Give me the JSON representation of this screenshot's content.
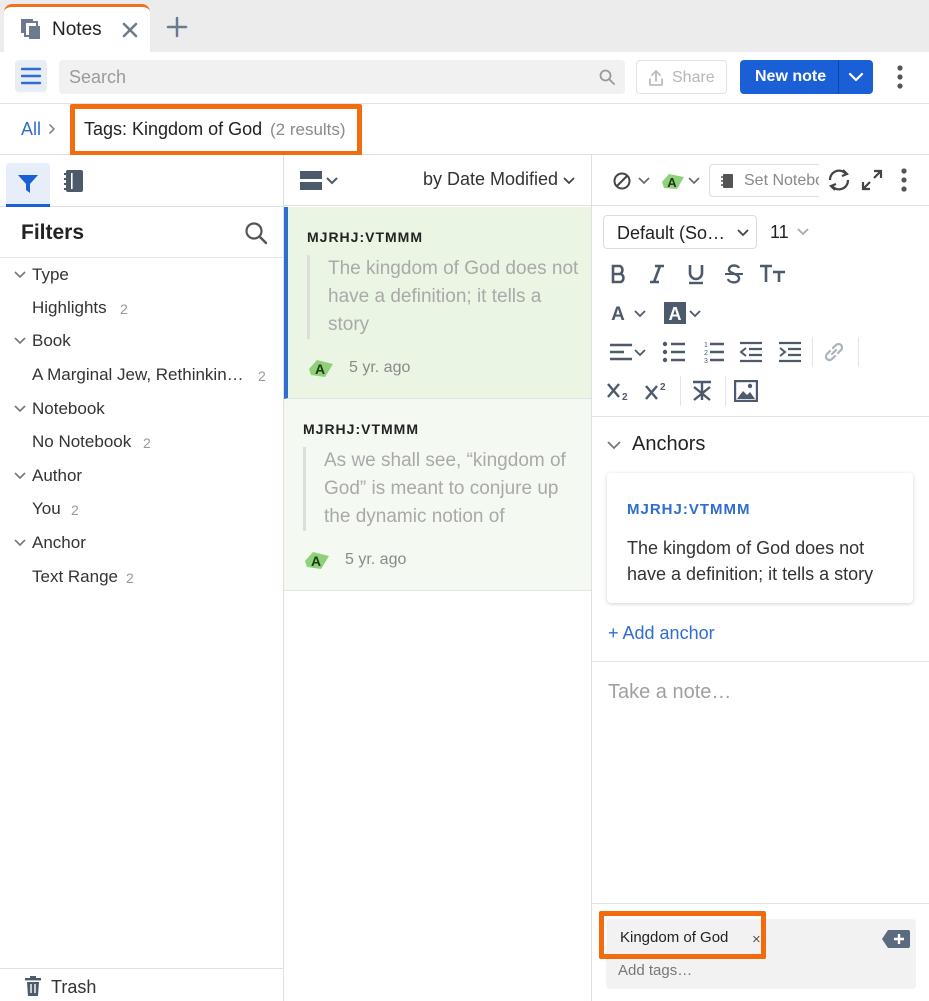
{
  "tab": {
    "title": "Notes",
    "icon": "notes-stack-icon"
  },
  "toolbar": {
    "search_placeholder": "Search",
    "share_label": "Share",
    "new_note_label": "New note"
  },
  "breadcrumb": {
    "root": "All",
    "current": "Tags: Kingdom of God",
    "count": "(2 results)"
  },
  "filters": {
    "title": "Filters",
    "groups": [
      {
        "label": "Type",
        "items": [
          {
            "label": "Highlights",
            "count": "2"
          }
        ]
      },
      {
        "label": "Book",
        "items": [
          {
            "label": "A Marginal Jew, Rethinkin…",
            "count": "2"
          }
        ]
      },
      {
        "label": "Notebook",
        "items": [
          {
            "label": "No Notebook",
            "count": "2"
          }
        ]
      },
      {
        "label": "Author",
        "items": [
          {
            "label": "You",
            "count": "2"
          }
        ]
      },
      {
        "label": "Anchor",
        "items": [
          {
            "label": "Text Range",
            "count": "2"
          }
        ]
      }
    ],
    "trash_label": "Trash"
  },
  "list": {
    "sort_label": "by Date Modified",
    "notes": [
      {
        "ref": "MJRHJ:VTMMM",
        "quote": "The kingdom of God does not have a definition; it tells a story",
        "age": "5 yr. ago",
        "highlight_letter": "A",
        "selected": true
      },
      {
        "ref": "MJRHJ:VTMMM",
        "quote": "As we shall see, “kingdom of God” is meant to conjure up the dynamic notion of",
        "age": "5 yr. ago",
        "highlight_letter": "A",
        "selected": false
      }
    ]
  },
  "editor": {
    "set_notebook_label": "Set Notebook",
    "highlight_letter": "A",
    "font_family": "Default (So…",
    "font_size": "11",
    "text_color_letter": "A",
    "bg_color_letter": "A",
    "anchors_title": "Anchors",
    "anchor": {
      "ref": "MJRHJ:VTMMM",
      "text": "The kingdom of God does not have a definition; it tells a story"
    },
    "add_anchor_label": "+ Add anchor",
    "note_placeholder": "Take a note…",
    "tag": "Kingdom of God",
    "tag_remove": "×",
    "add_tags_placeholder": "Add tags…"
  },
  "colors": {
    "accent": "#1a5fd6",
    "link": "#2f6ecf",
    "highlight_box": "#f26b0f",
    "highlight_green": "#8fd07a",
    "selected_card": "#eaf5e4"
  }
}
